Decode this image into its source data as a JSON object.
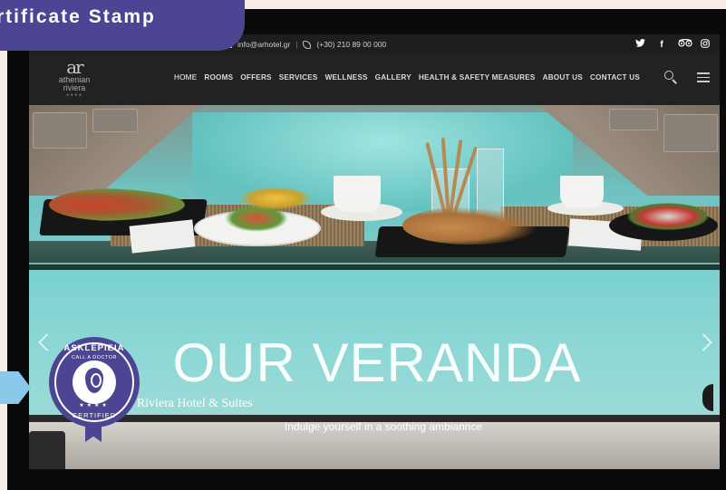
{
  "banner": {
    "label": "rtificate Stamp"
  },
  "topbar": {
    "email": "info@arhotel.gr",
    "separator": "|",
    "phone": "(+30) 210 89 00 000",
    "social": [
      {
        "icon": "twitter-icon",
        "glyph": "🐦"
      },
      {
        "icon": "facebook-icon",
        "glyph": "f"
      },
      {
        "icon": "tripadvisor-icon",
        "glyph": "oo"
      },
      {
        "icon": "instagram-icon",
        "glyph": "◎"
      }
    ]
  },
  "logo": {
    "mark": "ar",
    "name_line1": "athenian",
    "name_line2": "riviera",
    "stars": "★★★★"
  },
  "nav": {
    "items": [
      "HOME",
      "ROOMS",
      "OFFERS",
      "SERVICES",
      "WELLNESS",
      "GALLERY",
      "HEALTH & SAFETY MEASURES",
      "ABOUT US",
      "CONTACT US"
    ],
    "active": "HOME"
  },
  "hero": {
    "title": "OUR VERANDA",
    "subtitle": "Athenian Riviera Hotel & Suites",
    "tagline": "Indulge yourself in a soothing ambiannce"
  },
  "badge": {
    "top": "ASKLEPIEIA",
    "mid": "CALL A DOCTOR",
    "bottom": "CERTIFIED"
  },
  "colors": {
    "brand_purple": "#4c4593",
    "pool": "#7ad1cf",
    "nav_bg": "#232323",
    "page_bg": "#f7ede6"
  }
}
